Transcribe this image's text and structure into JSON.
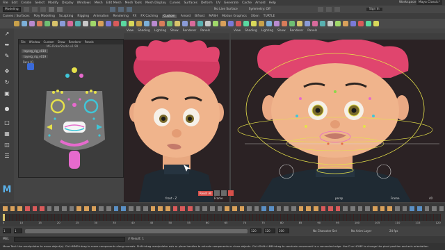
{
  "menubar": {
    "items": [
      "File",
      "Edit",
      "Create",
      "Select",
      "Modify",
      "Display",
      "Windows",
      "Mesh",
      "Edit Mesh",
      "Mesh Tools",
      "Mesh Display",
      "Curves",
      "Surfaces",
      "Deform",
      "UV",
      "Generate",
      "Cache",
      "Arnold",
      "Help"
    ],
    "workspace_label": "Workspace:",
    "workspace_value": "Maya Classic*"
  },
  "statusline": {
    "mode": "Modeling",
    "no_live_surface": "No Live Surface",
    "symmetry": "Symmetry: Off",
    "sign_in": "Sign In"
  },
  "shelf": {
    "tabs": [
      "Curves / Surfaces",
      "Poly Modeling",
      "Sculpting",
      "Rigging",
      "Animation",
      "Rendering",
      "FX",
      "FX Caching",
      "Custom",
      "Arnold",
      "Bifrost",
      "MASH",
      "Motion Graphics",
      "XGen",
      "TURTLE"
    ],
    "active_tab": "Custom",
    "icon_colors": [
      "#c9a14a",
      "#7cb0d8",
      "#b98ad0",
      "#d87c5a",
      "#6fbf73",
      "#d8c36a",
      "#8a9bd8",
      "#d86a9b",
      "#58b0b0",
      "#c8c8c8",
      "#a0d86a",
      "#d8a05a",
      "#7a7ad8",
      "#d85a5a",
      "#5ad8a0",
      "#d8d85a"
    ]
  },
  "picker": {
    "menus": [
      "File",
      "Window",
      "Custom",
      "Show",
      "Renderer",
      "Panels"
    ],
    "title": "MG-PickerStudio v1.99",
    "tab": "toyerg_rig_v019",
    "subtab": "toyerg_rig_v019",
    "face_label": "Face 01"
  },
  "viewport_left": {
    "menus": [
      "View",
      "Shading",
      "Lighting",
      "Show",
      "Renderer",
      "Panels"
    ],
    "camera_label": "front - Z",
    "frame_label": "Frame",
    "frame_value": "60"
  },
  "viewport_right": {
    "menus": [
      "View",
      "Shading",
      "Lighting",
      "Show",
      "Renderer",
      "Panels"
    ],
    "camera_label": "persp",
    "frame_label": "Frame",
    "frame_value": "40"
  },
  "cam_buttons": {
    "reset_label": "Reset All"
  },
  "timeline": {
    "start_frame": "1",
    "ticks": [
      "5",
      "10",
      "15",
      "20",
      "25",
      "30",
      "35",
      "40",
      "45",
      "50",
      "55",
      "60",
      "65",
      "70",
      "75",
      "80",
      "85",
      "90",
      "95",
      "100",
      "105",
      "110",
      "115",
      "120"
    ],
    "current_frame": "1"
  },
  "range": {
    "start": "1",
    "inner_start": "1",
    "inner_end": "120",
    "end": "120",
    "end2": "200",
    "character_set": "No Character Set",
    "anim_layer": "No Anim Layer",
    "fps": "24 fps"
  },
  "command": {
    "lang": "MEL",
    "result": "// Result: 1"
  },
  "help": {
    "text": "Move Tool: Use manipulator to move object(s). Ctrl+MMB+drag to move components along normals. Shift+drag manipulator axis or plane handles to extrude components or clone objects. Ctrl+Shift+LMB+drag to constrain movement to a connected edge. Use D or HOME to change the pivot position and axis orientation."
  },
  "colors": {
    "accent": "#5a8fc4",
    "skin": "#f0b48c",
    "hair": "#e0456e",
    "viewport_bg": "#2b2224"
  }
}
